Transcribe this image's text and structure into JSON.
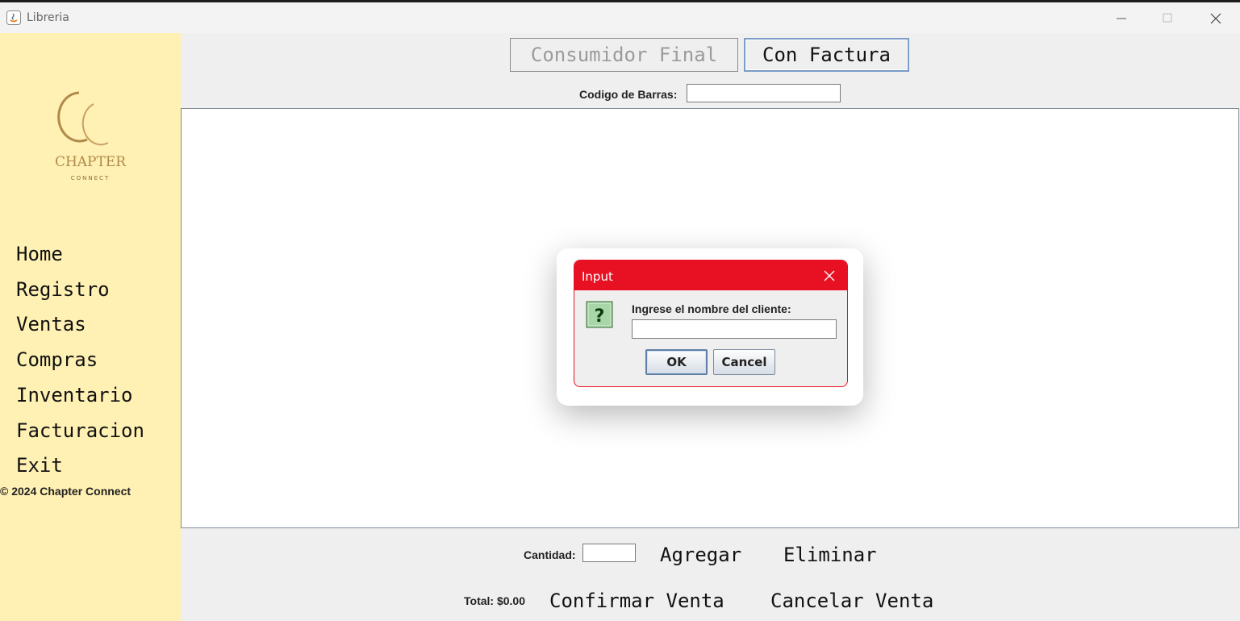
{
  "window": {
    "title": "Libreria"
  },
  "sidebar": {
    "logo": {
      "line1": "CHAPTER",
      "line2": "CONNECT",
      "monogram": "CC"
    },
    "nav": [
      {
        "label": "Home"
      },
      {
        "label": "Registro"
      },
      {
        "label": "Ventas"
      },
      {
        "label": "Compras"
      },
      {
        "label": "Inventario"
      },
      {
        "label": "Facturacion"
      },
      {
        "label": "Exit"
      }
    ],
    "copyright": "© 2024 Chapter Connect"
  },
  "main": {
    "mode_buttons": {
      "consumidor": "Consumidor Final",
      "factura": "Con Factura"
    },
    "barcode": {
      "label": "Codigo de Barras:",
      "value": ""
    },
    "cantidad": {
      "label": "Cantidad:",
      "value": ""
    },
    "actions": {
      "agregar": "Agregar",
      "eliminar": "Eliminar",
      "confirmar": "Confirmar Venta",
      "cancelar": "Cancelar Venta"
    },
    "total": "Total: $0.00"
  },
  "dialog": {
    "title": "Input",
    "prompt": "Ingrese el nombre del cliente:",
    "value": "",
    "ok": "OK",
    "cancel": "Cancel",
    "icon": "question-icon"
  },
  "colors": {
    "sidebar_bg": "#fff0b3",
    "dialog_accent": "#e81123",
    "logo_gold": "#b08a4a"
  }
}
